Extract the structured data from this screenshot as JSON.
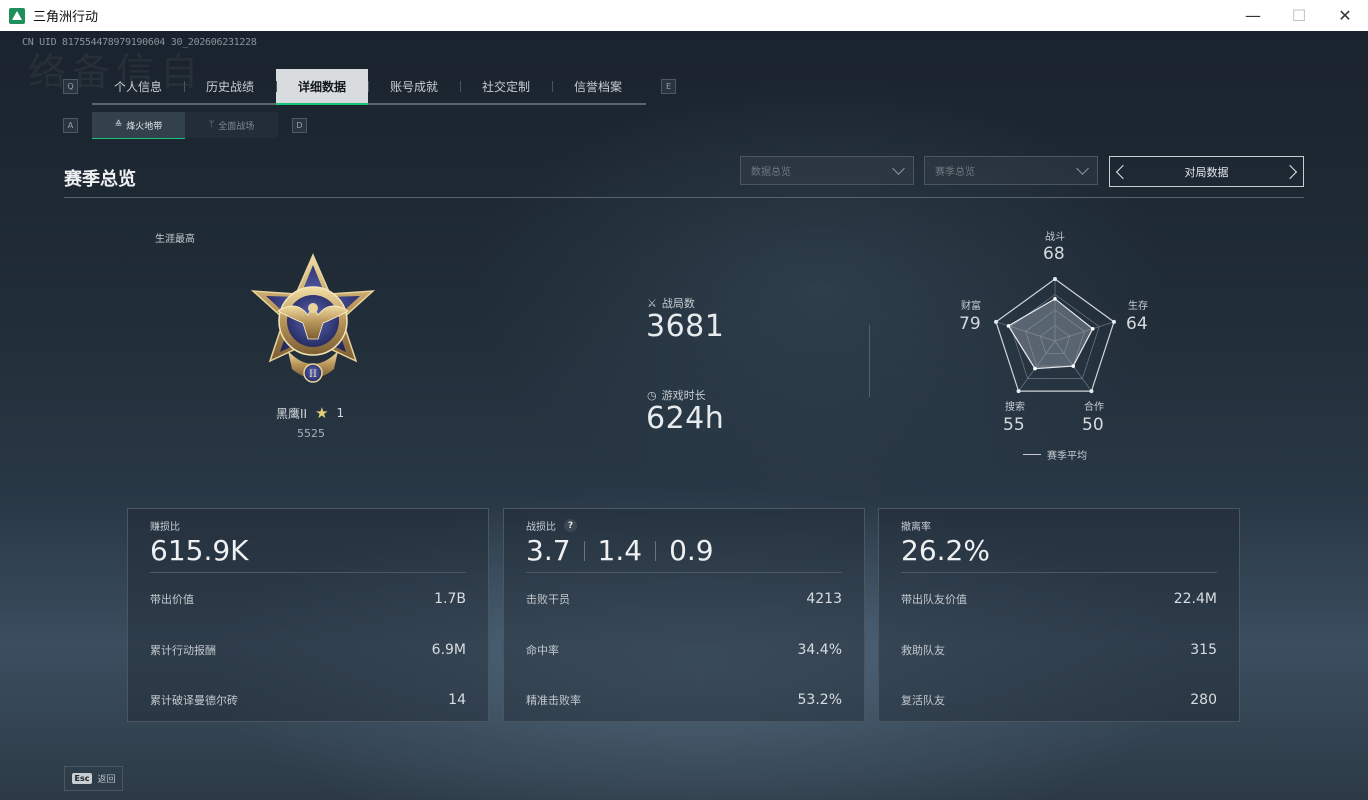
{
  "window": {
    "title": "三角洲行动",
    "minimize": "—",
    "maximize": "☐",
    "close": "✕"
  },
  "uid": "CN UID 817554478979190604 30_202606231228",
  "bg_word": "络备信自",
  "tabs": {
    "left_key": "Q",
    "right_key": "E",
    "items": [
      {
        "label": "个人信息"
      },
      {
        "label": "历史战绩"
      },
      {
        "label": "详细数据",
        "active": true
      },
      {
        "label": "账号成就"
      },
      {
        "label": "社交定制"
      },
      {
        "label": "信誉档案"
      }
    ]
  },
  "subtabs": {
    "left_key": "A",
    "right_key": "D",
    "items": [
      {
        "label": "烽火地带",
        "icon": "≙",
        "active": true
      },
      {
        "label": "全面战场",
        "icon": "ᛘ"
      }
    ]
  },
  "section": {
    "title": "赛季总览"
  },
  "filters": {
    "data_overview": "数据总览",
    "season_overview": "赛季总览",
    "match_data": "对局数据"
  },
  "career": {
    "label": "生涯最高",
    "rank_name": "黑鹰II",
    "stars": "1",
    "score": "5525",
    "medal_roman": "II"
  },
  "stats": {
    "matches_label": "战局数",
    "matches_value": "3681",
    "playtime_label": "游戏时长",
    "playtime_value": "624h"
  },
  "radar": {
    "axes": [
      {
        "label": "战斗",
        "value": 68
      },
      {
        "label": "生存",
        "value": 64
      },
      {
        "label": "合作",
        "value": 50
      },
      {
        "label": "搜索",
        "value": 55
      },
      {
        "label": "财富",
        "value": 79
      }
    ],
    "legend": "赛季平均"
  },
  "cards": [
    {
      "head": "赚损比",
      "big": [
        "615.9K"
      ],
      "rows": [
        {
          "label": "带出价值",
          "value": "1.7B"
        },
        {
          "label": "累计行动报酬",
          "value": "6.9M"
        },
        {
          "label": "累计破译曼德尔砖",
          "value": "14"
        }
      ]
    },
    {
      "head": "战损比",
      "help": "?",
      "big": [
        "3.7",
        "1.4",
        "0.9"
      ],
      "rows": [
        {
          "label": "击败干员",
          "value": "4213"
        },
        {
          "label": "命中率",
          "value": "34.4%"
        },
        {
          "label": "精准击败率",
          "value": "53.2%"
        }
      ]
    },
    {
      "head": "撤离率",
      "big": [
        "26.2%"
      ],
      "rows": [
        {
          "label": "带出队友价值",
          "value": "22.4M"
        },
        {
          "label": "救助队友",
          "value": "315"
        },
        {
          "label": "复活队友",
          "value": "280"
        }
      ]
    }
  ],
  "footer": {
    "esc_key": "Esc",
    "back_label": "返回"
  },
  "colors": {
    "accent": "#19c279",
    "panel_border": "#4b5660",
    "text": "#d9dde3"
  }
}
